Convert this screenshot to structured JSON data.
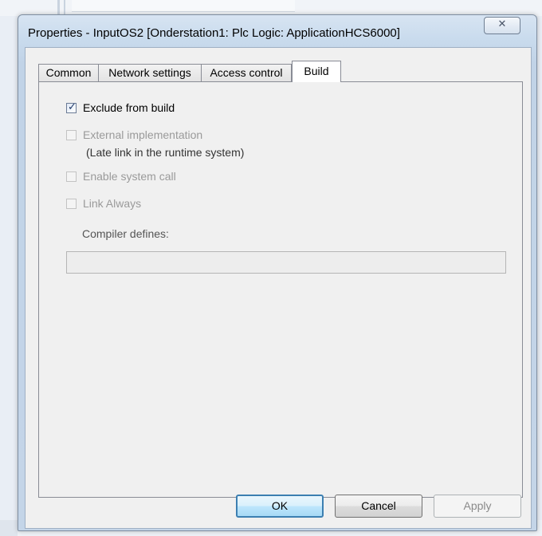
{
  "window": {
    "title": "Properties - InputOS2 [Onderstation1: Plc Logic: ApplicationHCS6000]",
    "close_glyph": "✕"
  },
  "tabs": [
    {
      "label": "Common",
      "active": false
    },
    {
      "label": "Network settings",
      "active": false
    },
    {
      "label": "Access control",
      "active": false
    },
    {
      "label": "Build",
      "active": true
    }
  ],
  "build": {
    "exclude_from_build": {
      "label": "Exclude from build",
      "checked": true,
      "enabled": true
    },
    "external_implementation": {
      "label": "External implementation",
      "sublabel": "(Late link in the runtime system)",
      "checked": false,
      "enabled": false
    },
    "enable_system_call": {
      "label": "Enable system call",
      "checked": false,
      "enabled": false
    },
    "link_always": {
      "label": "Link Always",
      "checked": false,
      "enabled": false
    },
    "compiler_defines": {
      "label": "Compiler defines:",
      "value": ""
    }
  },
  "buttons": {
    "ok": "OK",
    "cancel": "Cancel",
    "apply": "Apply"
  },
  "icons": {
    "close": "close-icon",
    "checkmark": "checkmark-icon"
  }
}
